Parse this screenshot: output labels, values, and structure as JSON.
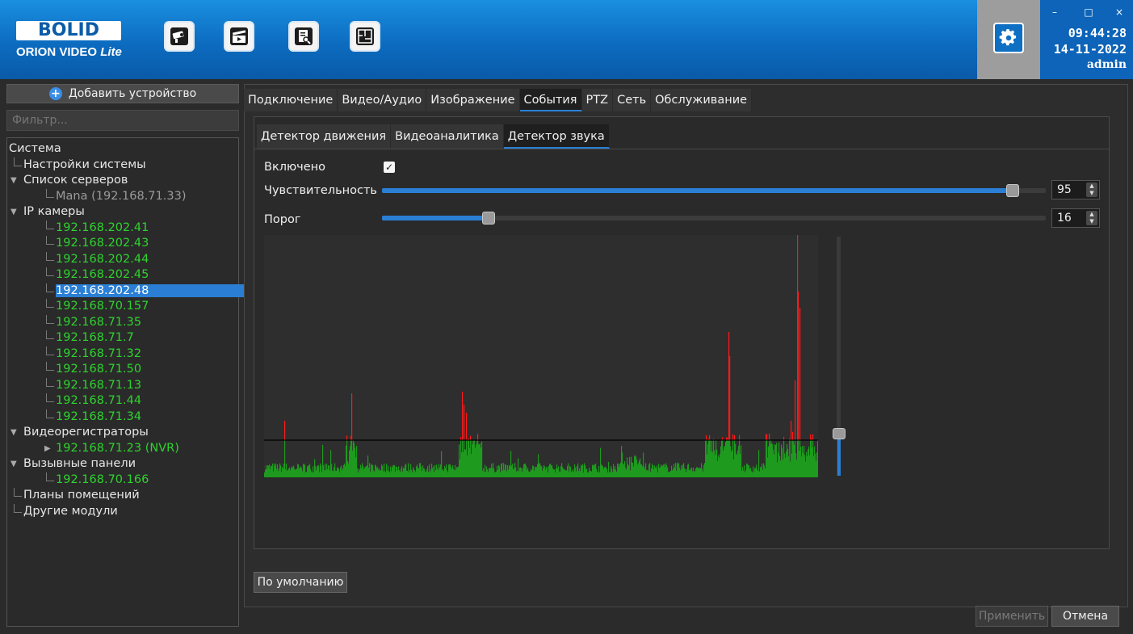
{
  "header": {
    "logo_text": "BOLID",
    "logo_sub": "ORION VIDEO",
    "logo_sub_italic": "Lite",
    "nav_icons": [
      "camera-icon",
      "video-clip-icon",
      "document-search-icon",
      "floor-plan-icon"
    ],
    "settings_icon": "gear-icon",
    "clock_time": "09:44:28",
    "clock_date": "14-11-2022",
    "user": "admin",
    "window_controls": [
      "–",
      "□",
      "×"
    ],
    "accent_color": "#0c6cc0"
  },
  "sidebar": {
    "add_device_label": "Добавить устройство",
    "filter_placeholder": "Фильтр...",
    "tree": {
      "system": "Система",
      "system_settings": "Настройки системы",
      "servers_list": "Список серверов",
      "server_item": "Mana (192.168.71.33)",
      "ip_cameras": "IP камеры",
      "cameras": [
        "192.168.202.41",
        "192.168.202.43",
        "192.168.202.44",
        "192.168.202.45",
        "192.168.202.48",
        "192.168.70.157",
        "192.168.71.35",
        "192.168.71.7",
        "192.168.71.32",
        "192.168.71.50",
        "192.168.71.13",
        "192.168.71.44",
        "192.168.71.34"
      ],
      "selected_camera": "192.168.202.48",
      "recorders": "Видеорегистраторы",
      "recorder_item": "192.168.71.23 (NVR)",
      "intercoms": "Вызывные панели",
      "intercom_item": "192.168.70.166",
      "floor_plans": "Планы помещений",
      "other_modules": "Другие модули"
    }
  },
  "main_tabs": [
    "Подключение",
    "Видео/Аудио",
    "Изображение",
    "События",
    "PTZ",
    "Сеть",
    "Обслуживание"
  ],
  "main_tab_active": "События",
  "sub_tabs": [
    "Детектор движения",
    "Видеоаналитика",
    "Детектор звука"
  ],
  "sub_tab_active": "Детектор звука",
  "sound_detector": {
    "enabled_label": "Включено",
    "enabled": true,
    "sensitivity_label": "Чувствительность",
    "sensitivity_value": "95",
    "sensitivity_fraction": 0.95,
    "threshold_label": "Порог",
    "threshold_value": "16",
    "threshold_fraction": 0.16,
    "level_fraction": 0.16,
    "colors": {
      "below": "#1e9a1e",
      "above": "#ff1a1a"
    }
  },
  "buttons": {
    "default": "По умолчанию",
    "apply": "Применить",
    "cancel": "Отмена"
  }
}
